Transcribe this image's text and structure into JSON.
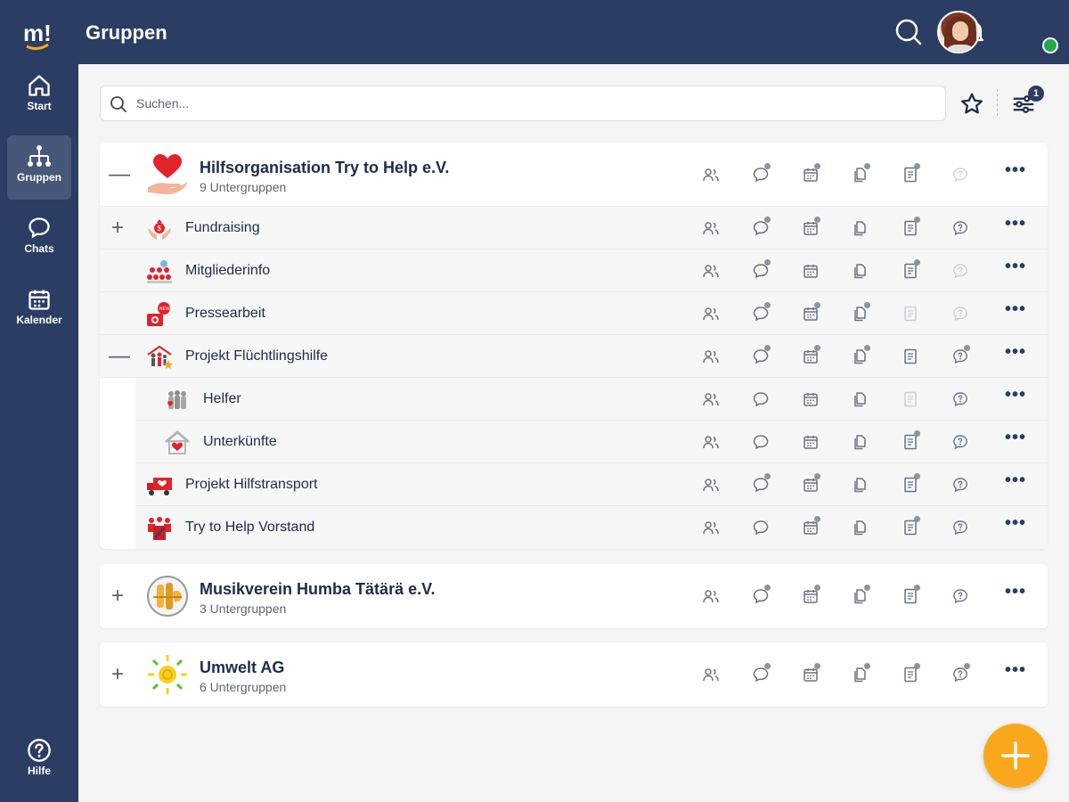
{
  "header": {
    "title": "Gruppen"
  },
  "nav": {
    "logo_text": "m!",
    "start": "Start",
    "groups": "Gruppen",
    "chats": "Chats",
    "calendar": "Kalender",
    "help": "Hilfe"
  },
  "search": {
    "placeholder": "Suchen..."
  },
  "filter": {
    "badge": "1"
  },
  "groups": [
    {
      "name": "Hilfsorganisation Try to Help e.V.",
      "subtitle": "9 Untergruppen",
      "subgroups": [
        {
          "name": "Fundraising"
        },
        {
          "name": "Mitgliederinfo"
        },
        {
          "name": "Pressearbeit"
        },
        {
          "name": "Projekt Flüchtlingshilfe"
        },
        {
          "name": "Helfer"
        },
        {
          "name": "Unterkünfte"
        },
        {
          "name": "Projekt Hilfstransport"
        },
        {
          "name": "Try to Help Vorstand"
        }
      ]
    },
    {
      "name": "Musikverein Humba Tätärä e.V.",
      "subtitle": "3 Untergruppen"
    },
    {
      "name": "Umwelt AG",
      "subtitle": "6 Untergruppen"
    }
  ],
  "icons": {
    "members": "members-icon",
    "chat": "chat-icon",
    "calendar": "calendar-icon",
    "files": "files-icon",
    "documents": "documents-icon",
    "survey": "survey-icon",
    "more": "more-icon"
  },
  "colors": {
    "navy": "#2b3d63",
    "accent": "#f9a81b",
    "heart": "#e2232a"
  }
}
